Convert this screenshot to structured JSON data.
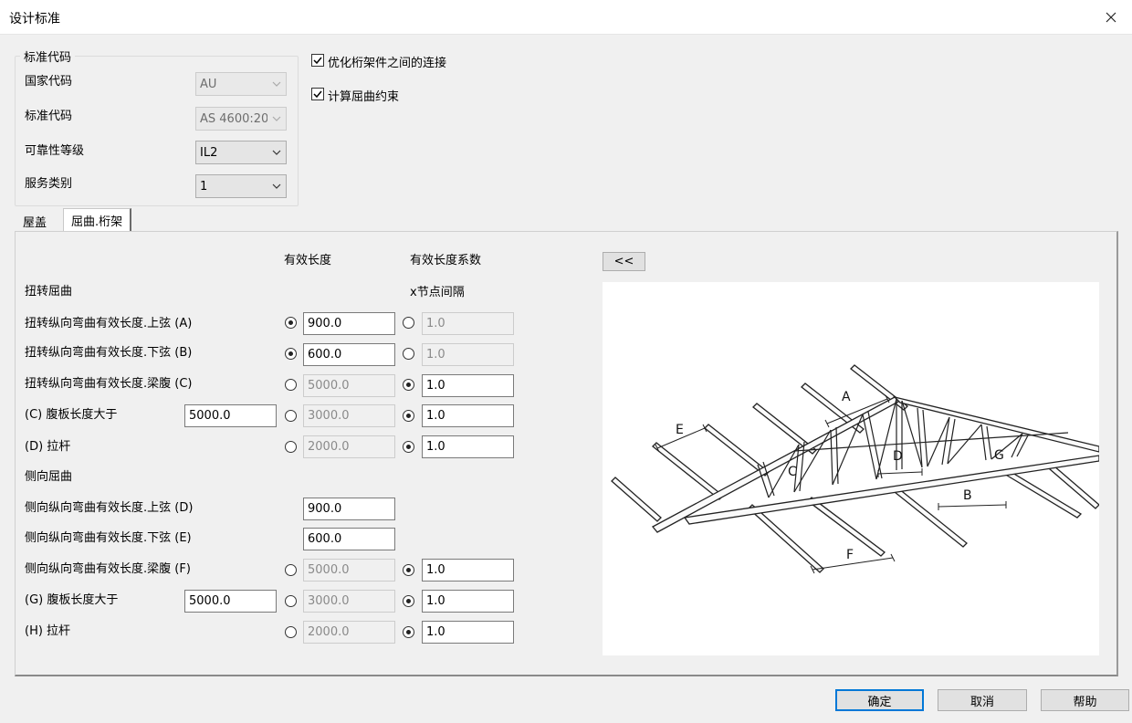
{
  "window": {
    "title": "设计标准"
  },
  "standard_group": {
    "legend": "标准代码",
    "country_label": "国家代码",
    "country_value": "AU",
    "standard_label": "标准代码",
    "standard_value": "AS 4600:20",
    "reliability_label": "可靠性等级",
    "reliability_value": "IL2",
    "service_label": "服务类别",
    "service_value": "1"
  },
  "options": {
    "optimize_label": "优化桁架件之间的连接",
    "buckling_label": "计算屈曲约束"
  },
  "tabs": [
    {
      "label": "屋盖"
    },
    {
      "label": "屈曲.桁架"
    }
  ],
  "buckling": {
    "col_length": "有效长度",
    "col_factor": "有效长度系数",
    "col_factor_sub": "x节点间隔",
    "collapse_button": "<<",
    "torsional_title": "扭转屈曲",
    "lateral_title": "侧向屈曲",
    "rows": [
      {
        "label": "扭转纵向弯曲有效长度.上弦 (A)",
        "length": "900.0",
        "factor": "1.0"
      },
      {
        "label": "扭转纵向弯曲有效长度.下弦 (B)",
        "length": "600.0",
        "factor": "1.0"
      },
      {
        "label": "扭转纵向弯曲有效长度.梁腹 (C)",
        "length": "5000.0",
        "factor": "1.0"
      },
      {
        "label": "(C) 腹板长度大于",
        "extra": "5000.0",
        "length": "3000.0",
        "factor": "1.0"
      },
      {
        "label": "(D) 拉杆",
        "length": "2000.0",
        "factor": "1.0"
      },
      {
        "label": "侧向纵向弯曲有效长度.上弦 (D)",
        "length": "900.0"
      },
      {
        "label": "侧向纵向弯曲有效长度.下弦 (E)",
        "length": "600.0"
      },
      {
        "label": "侧向纵向弯曲有效长度.梁腹 (F)",
        "length": "5000.0",
        "factor": "1.0"
      },
      {
        "label": "(G) 腹板长度大于",
        "extra": "5000.0",
        "length": "3000.0",
        "factor": "1.0"
      },
      {
        "label": "(H) 拉杆",
        "length": "2000.0",
        "factor": "1.0"
      }
    ]
  },
  "diagram_labels": {
    "a": "A",
    "b": "B",
    "c": "C",
    "d": "D",
    "e": "E",
    "f": "F",
    "g": "G"
  },
  "footer": {
    "ok": "确定",
    "cancel": "取消",
    "help": "帮助"
  }
}
